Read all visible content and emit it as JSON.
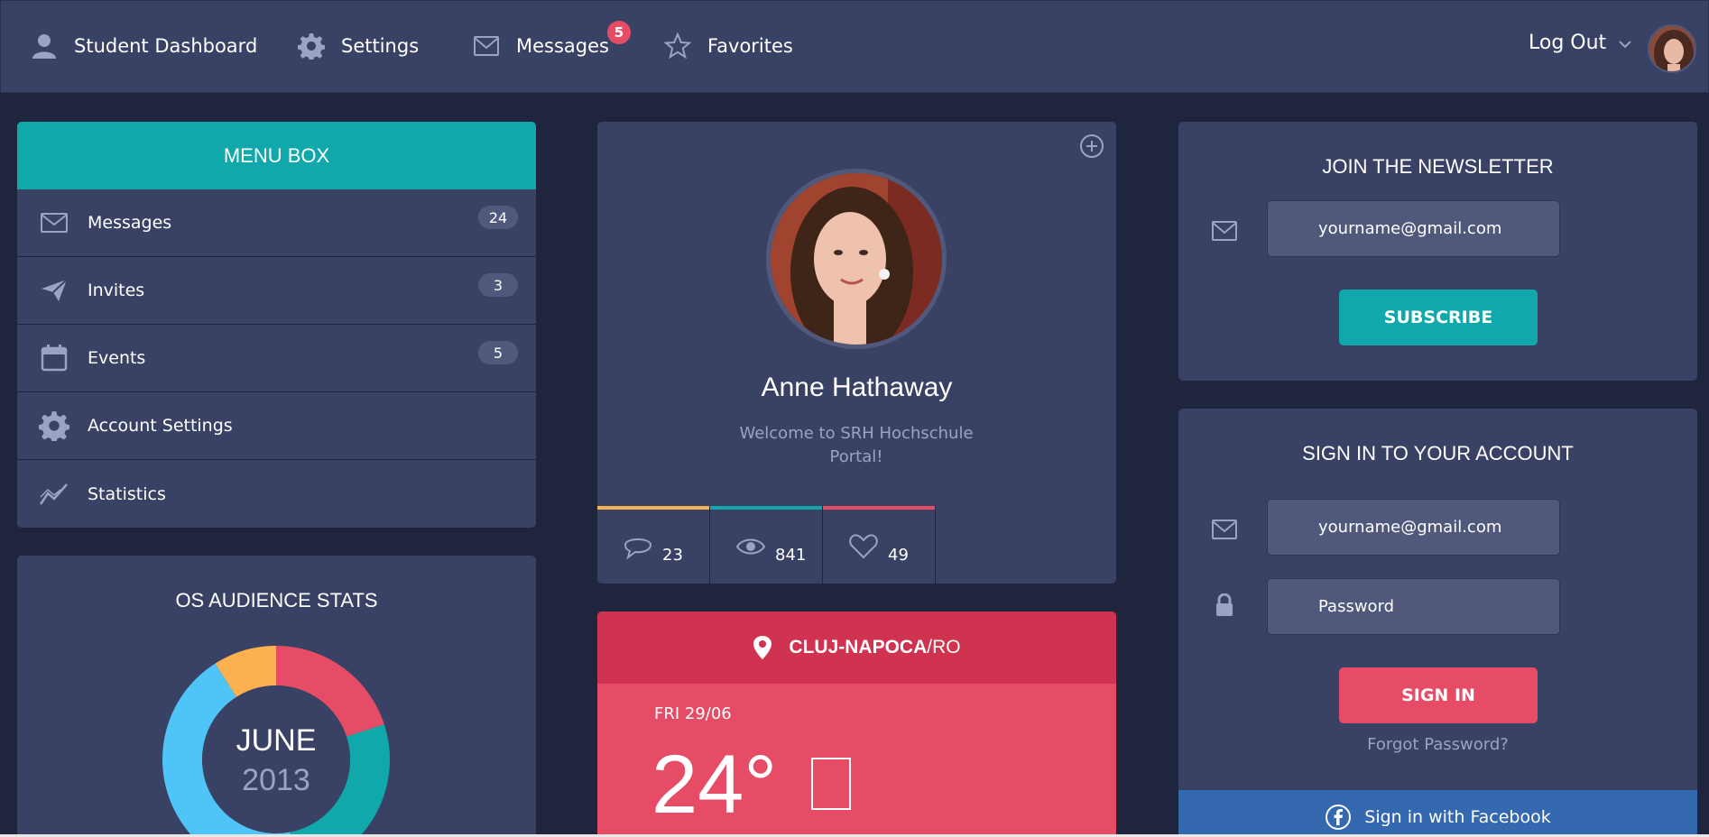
{
  "nav": {
    "items": [
      {
        "label": "Student Dashboard",
        "icon": "user-icon"
      },
      {
        "label": "Settings",
        "icon": "gear-icon"
      },
      {
        "label": "Messages",
        "icon": "envelope-icon",
        "badge": "5"
      },
      {
        "label": "Favorites",
        "icon": "star-icon"
      }
    ],
    "logout_label": "Log Out"
  },
  "menu": {
    "title": "MENU BOX",
    "items": [
      {
        "label": "Messages",
        "icon": "envelope-icon",
        "count": "24"
      },
      {
        "label": "Invites",
        "icon": "paper-plane-icon",
        "count": "3"
      },
      {
        "label": "Events",
        "icon": "calendar-icon",
        "count": "5"
      },
      {
        "label": "Account Settings",
        "icon": "gear-icon"
      },
      {
        "label": "Statistics",
        "icon": "chart-line-icon"
      }
    ]
  },
  "os_stats": {
    "title": "OS AUDIENCE STATS",
    "month": "JUNE",
    "year": "2013",
    "chart_data": {
      "type": "pie",
      "title": "OS AUDIENCE STATS",
      "slices": [
        {
          "value": 20,
          "color": "#e64c65"
        },
        {
          "value": 27,
          "color": "#11a8ab"
        },
        {
          "value": 44,
          "color": "#4fc4f6"
        },
        {
          "value": 9,
          "color": "#fcb150"
        }
      ]
    }
  },
  "profile": {
    "name": "Anne Hathaway",
    "welcome": "Welcome to SRH Hochschule Portal!",
    "stats": [
      {
        "value": "23",
        "icon": "comment-icon",
        "color": "#fcb150"
      },
      {
        "value": "841",
        "icon": "eye-icon",
        "color": "#11a8ab"
      },
      {
        "value": "49",
        "icon": "heart-icon",
        "color": "#e64c65"
      }
    ]
  },
  "weather": {
    "city": "CLUJ-NAPOCA",
    "country": "/RO",
    "date": "FRI 29/06",
    "temperature": "24°"
  },
  "newsletter": {
    "title": "JOIN THE NEWSLETTER",
    "email_value": "yourname@gmail.com",
    "button": "SUBSCRIBE"
  },
  "signin": {
    "title": "SIGN IN TO YOUR ACCOUNT",
    "email_value": "yourname@gmail.com",
    "password_placeholder": "Password",
    "button": "SIGN IN",
    "forgot": "Forgot Password?",
    "facebook": "Sign in with Facebook"
  },
  "colors": {
    "background": "#1f253d",
    "panel": "#394264",
    "teal": "#11a8ab",
    "red": "#e64c65",
    "orange": "#fcb150",
    "blue": "#4fc4f6",
    "facebook": "#3468af"
  }
}
